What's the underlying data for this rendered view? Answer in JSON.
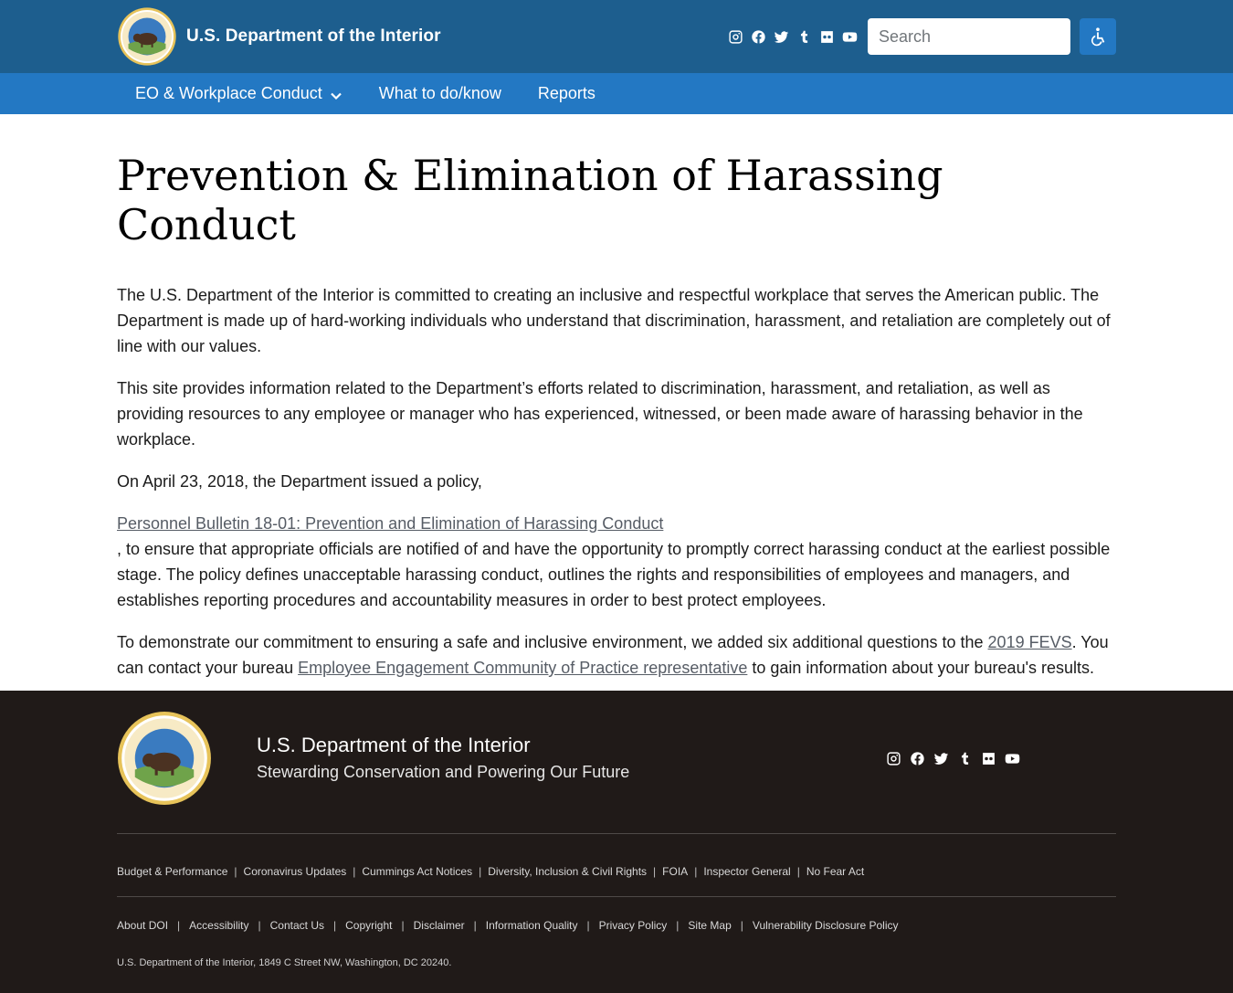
{
  "header": {
    "site_title": "U.S. Department of the Interior",
    "search_placeholder": "Search",
    "social_icons": [
      "instagram-icon",
      "facebook-icon",
      "twitter-icon",
      "tumblr-icon",
      "flickr-icon",
      "youtube-icon"
    ],
    "colors": {
      "topbar": "#1d5e8e",
      "navbar": "#2378c3",
      "accessibility_button": "#2378c3"
    }
  },
  "nav": {
    "items": [
      {
        "label": "EO & Workplace Conduct",
        "has_dropdown": true
      },
      {
        "label": "What to do/know"
      },
      {
        "label": "Reports"
      }
    ]
  },
  "main": {
    "title": "Prevention & Elimination of Harassing Conduct",
    "p1": "The U.S. Department of the Interior is committed to creating an inclusive and respectful workplace that serves the American public. The Department is made up of hard-working individuals who understand that discrimination, harassment, and retaliation are completely out of line with our values.",
    "p2": "This site provides information related to the Department’s efforts related to discrimination, harassment, and retaliation, as well as providing resources to any employee or manager who has experienced, witnessed, or been made aware of harassing behavior in the workplace.",
    "p3": "On April 23, 2018, the Department issued a policy,",
    "policy_link": "Personnel Bulletin 18-01: Prevention and Elimination of Harassing Conduct",
    "p4": ", to ensure that appropriate officials are notified of and have the opportunity to promptly correct harassing conduct at the earliest possible stage. The policy defines unacceptable harassing conduct, outlines the rights and responsibilities of employees and managers, and establishes reporting procedures and accountability measures in order to best protect employees.",
    "p5_a": "To demonstrate our commitment to ensuring a safe and inclusive environment, we added six additional questions to the ",
    "fevs_link": "2019 FEVS",
    "p5_b": ". You can contact your bureau  ",
    "community_link": "Employee Engagement Community of Practice representative",
    "p5_c": " to gain information about your bureau's results."
  },
  "footer": {
    "name": "U.S. Department of the Interior",
    "tagline": "Stewarding Conservation and Powering Our Future",
    "social_icons": [
      "instagram-icon",
      "facebook-icon",
      "twitter-icon",
      "tumblr-icon",
      "flickr-icon",
      "youtube-icon"
    ],
    "links_row1": [
      "Budget & Performance",
      "Coronavirus Updates",
      "Cummings Act Notices",
      "Diversity, Inclusion & Civil Rights",
      "FOIA",
      "Inspector General",
      "No Fear Act"
    ],
    "links_row2": [
      "About DOI",
      "Accessibility",
      "Contact Us",
      "Copyright",
      "Disclaimer",
      "Information Quality",
      "Privacy Policy",
      "Site Map",
      "Vulnerability Disclosure Policy"
    ],
    "address": "U.S. Department of the Interior, 1849 C Street NW, Washington, DC 20240.",
    "colors": {
      "background": "#201a18"
    }
  }
}
